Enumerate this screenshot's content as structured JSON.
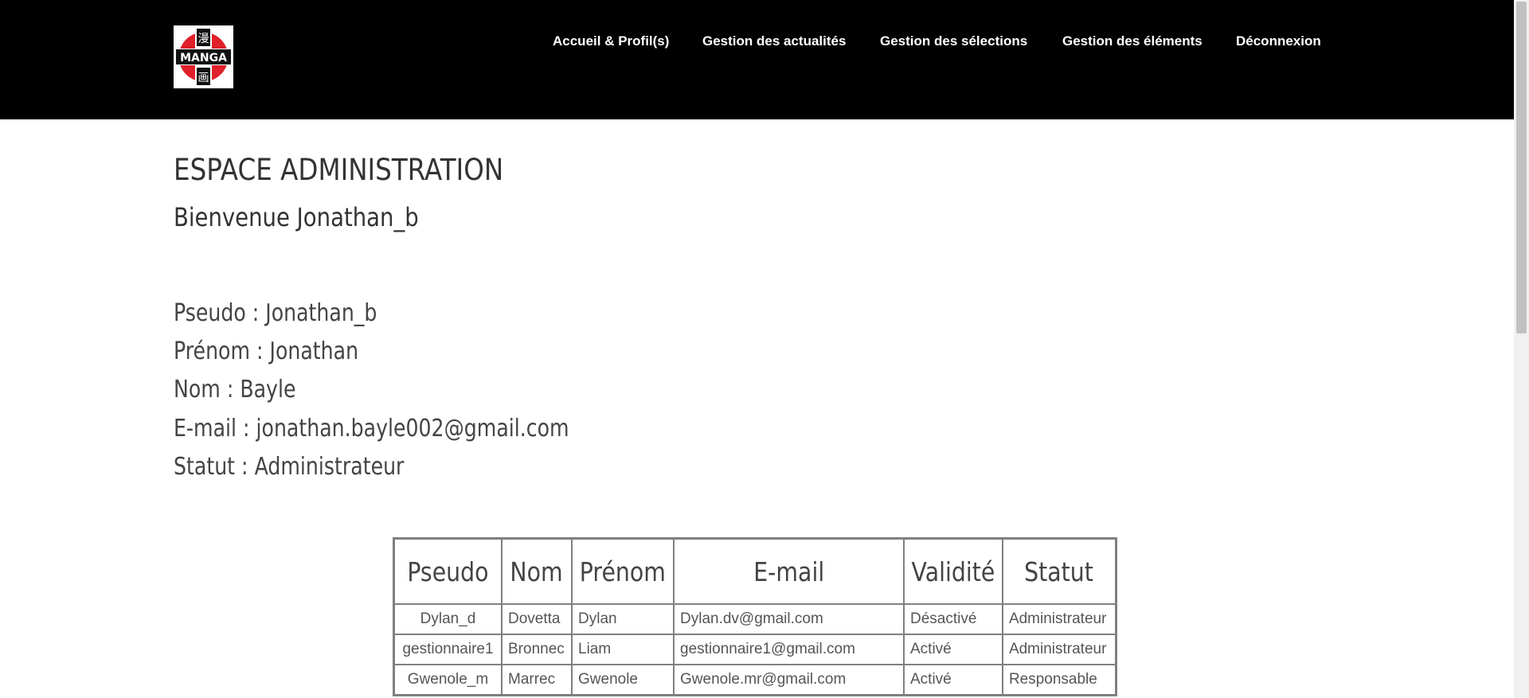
{
  "header": {
    "logo_text": "MANGA",
    "logo_kanji_top": "漫",
    "logo_kanji_bottom": "画",
    "nav": [
      {
        "label": "Accueil & Profil(s)"
      },
      {
        "label": "Gestion des actualités"
      },
      {
        "label": "Gestion des sélections"
      },
      {
        "label": "Gestion des éléments"
      },
      {
        "label": "Déconnexion"
      }
    ]
  },
  "main": {
    "title": "ESPACE ADMINISTRATION",
    "welcome": "Bienvenue Jonathan_b",
    "profile": {
      "pseudo": "Pseudo : Jonathan_b",
      "prenom": "Prénom : Jonathan",
      "nom": "Nom : Bayle",
      "email": "E-mail : jonathan.bayle002@gmail.com",
      "statut": "Statut : Administrateur"
    }
  },
  "users_table": {
    "headers": [
      "Pseudo",
      "Nom",
      "Prénom",
      "E-mail",
      "Validité",
      "Statut"
    ],
    "rows": [
      [
        "Dylan_d",
        "Dovetta",
        "Dylan",
        "Dylan.dv@gmail.com",
        "Désactivé",
        "Administrateur"
      ],
      [
        "gestionnaire1",
        "Bronnec",
        "Liam",
        "gestionnaire1@gmail.com",
        "Activé",
        "Administrateur"
      ],
      [
        "Gwenole_m",
        "Marrec",
        "Gwenole",
        "Gwenole.mr@gmail.com",
        "Activé",
        "Responsable"
      ]
    ]
  },
  "colors": {
    "header_bg": "#000000",
    "logo_red": "#e0202a",
    "table_border": "#808080"
  }
}
